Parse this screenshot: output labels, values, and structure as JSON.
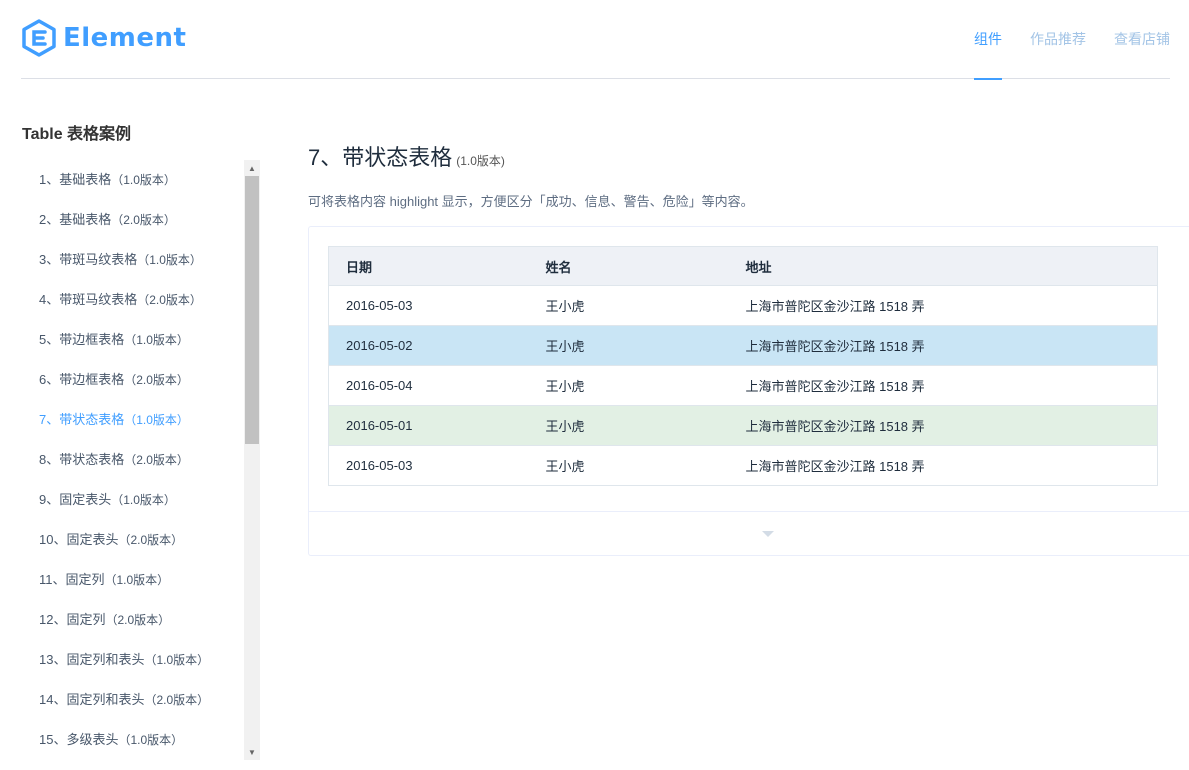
{
  "header": {
    "logo_text": "Element",
    "nav": [
      {
        "label": "组件",
        "active": true
      },
      {
        "label": "作品推荐",
        "active": false
      },
      {
        "label": "查看店铺",
        "active": false
      }
    ]
  },
  "sidebar": {
    "title": "Table 表格案例",
    "items": [
      {
        "label": "1、基础表格",
        "version": "（1.0版本）"
      },
      {
        "label": "2、基础表格",
        "version": "（2.0版本）"
      },
      {
        "label": "3、带斑马纹表格",
        "version": "（1.0版本）"
      },
      {
        "label": "4、带斑马纹表格",
        "version": "（2.0版本）"
      },
      {
        "label": "5、带边框表格",
        "version": "（1.0版本）"
      },
      {
        "label": "6、带边框表格",
        "version": "（2.0版本）"
      },
      {
        "label": "7、带状态表格",
        "version": "（1.0版本）"
      },
      {
        "label": "8、带状态表格",
        "version": "（2.0版本）"
      },
      {
        "label": "9、固定表头",
        "version": "（1.0版本）"
      },
      {
        "label": "10、固定表头",
        "version": "（2.0版本）"
      },
      {
        "label": "11、固定列",
        "version": "（1.0版本）"
      },
      {
        "label": "12、固定列",
        "version": "（2.0版本）"
      },
      {
        "label": "13、固定列和表头",
        "version": "（1.0版本）"
      },
      {
        "label": "14、固定列和表头",
        "version": "（2.0版本）"
      },
      {
        "label": "15、多级表头",
        "version": "（1.0版本）"
      }
    ],
    "active_index": 6
  },
  "main": {
    "title": "7、带状态表格",
    "title_version": "(1.0版本)",
    "description": "可将表格内容 highlight 显示，方便区分「成功、信息、警告、危险」等内容。",
    "table": {
      "headers": [
        "日期",
        "姓名",
        "地址"
      ],
      "rows": [
        {
          "date": "2016-05-03",
          "name": "王小虎",
          "address": "上海市普陀区金沙江路 1518 弄",
          "status": ""
        },
        {
          "date": "2016-05-02",
          "name": "王小虎",
          "address": "上海市普陀区金沙江路 1518 弄",
          "status": "info"
        },
        {
          "date": "2016-05-04",
          "name": "王小虎",
          "address": "上海市普陀区金沙江路 1518 弄",
          "status": ""
        },
        {
          "date": "2016-05-01",
          "name": "王小虎",
          "address": "上海市普陀区金沙江路 1518 弄",
          "status": "positive"
        },
        {
          "date": "2016-05-03",
          "name": "王小虎",
          "address": "上海市普陀区金沙江路 1518 弄",
          "status": ""
        }
      ]
    },
    "footer_icon": "caret-down-icon"
  },
  "colors": {
    "accent": "#409eff",
    "info_row": "#c9e5f5",
    "positive_row": "#e2f0e4",
    "header_bg": "#eef1f6"
  }
}
